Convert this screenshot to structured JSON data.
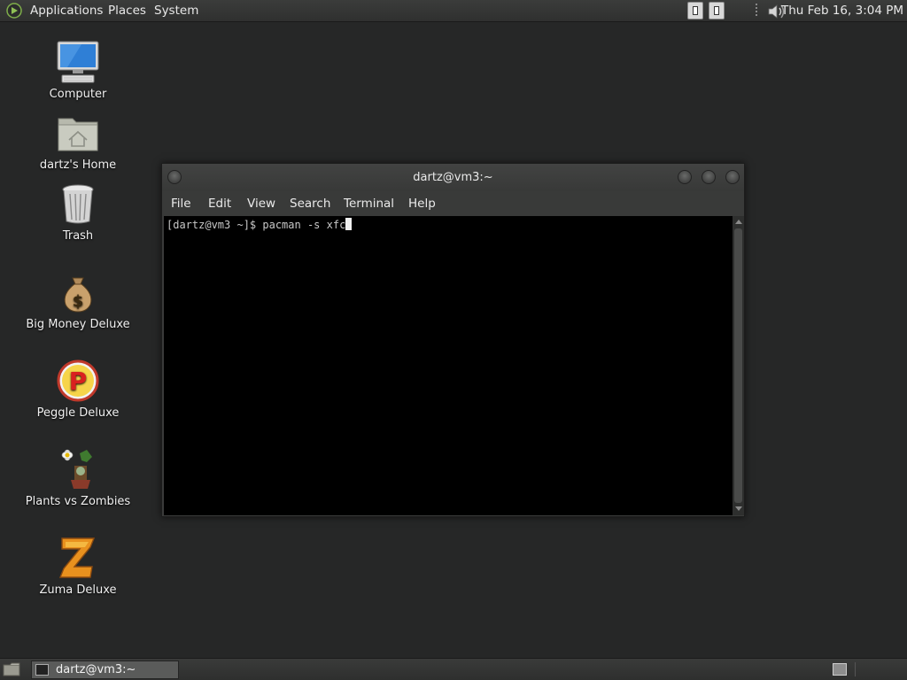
{
  "top_panel": {
    "menus": [
      "Applications",
      "Places",
      "System"
    ],
    "clock": "Thu Feb 16,  3:04 PM"
  },
  "desktop_icons": [
    {
      "label": "Computer",
      "icon": "computer-icon"
    },
    {
      "label": "dartz's Home",
      "icon": "home-folder-icon"
    },
    {
      "label": "Trash",
      "icon": "trash-icon"
    },
    {
      "label": "Big Money Deluxe",
      "icon": "money-bag-icon"
    },
    {
      "label": "Peggle Deluxe",
      "icon": "peggle-icon"
    },
    {
      "label": "Plants vs Zombies",
      "icon": "plants-vs-zombies-icon"
    },
    {
      "label": "Zuma Deluxe",
      "icon": "zuma-icon"
    }
  ],
  "terminal": {
    "title": "dartz@vm3:~",
    "menus": [
      "File",
      "Edit",
      "View",
      "Search",
      "Terminal",
      "Help"
    ],
    "line": "[dartz@vm3 ~]$ pacman -s xfc"
  },
  "bottom_panel": {
    "task_label": "dartz@vm3:~"
  },
  "colors": {
    "desktop_bg": "#262727",
    "terminal_bg": "#000000",
    "panel_bg": "#353635"
  }
}
